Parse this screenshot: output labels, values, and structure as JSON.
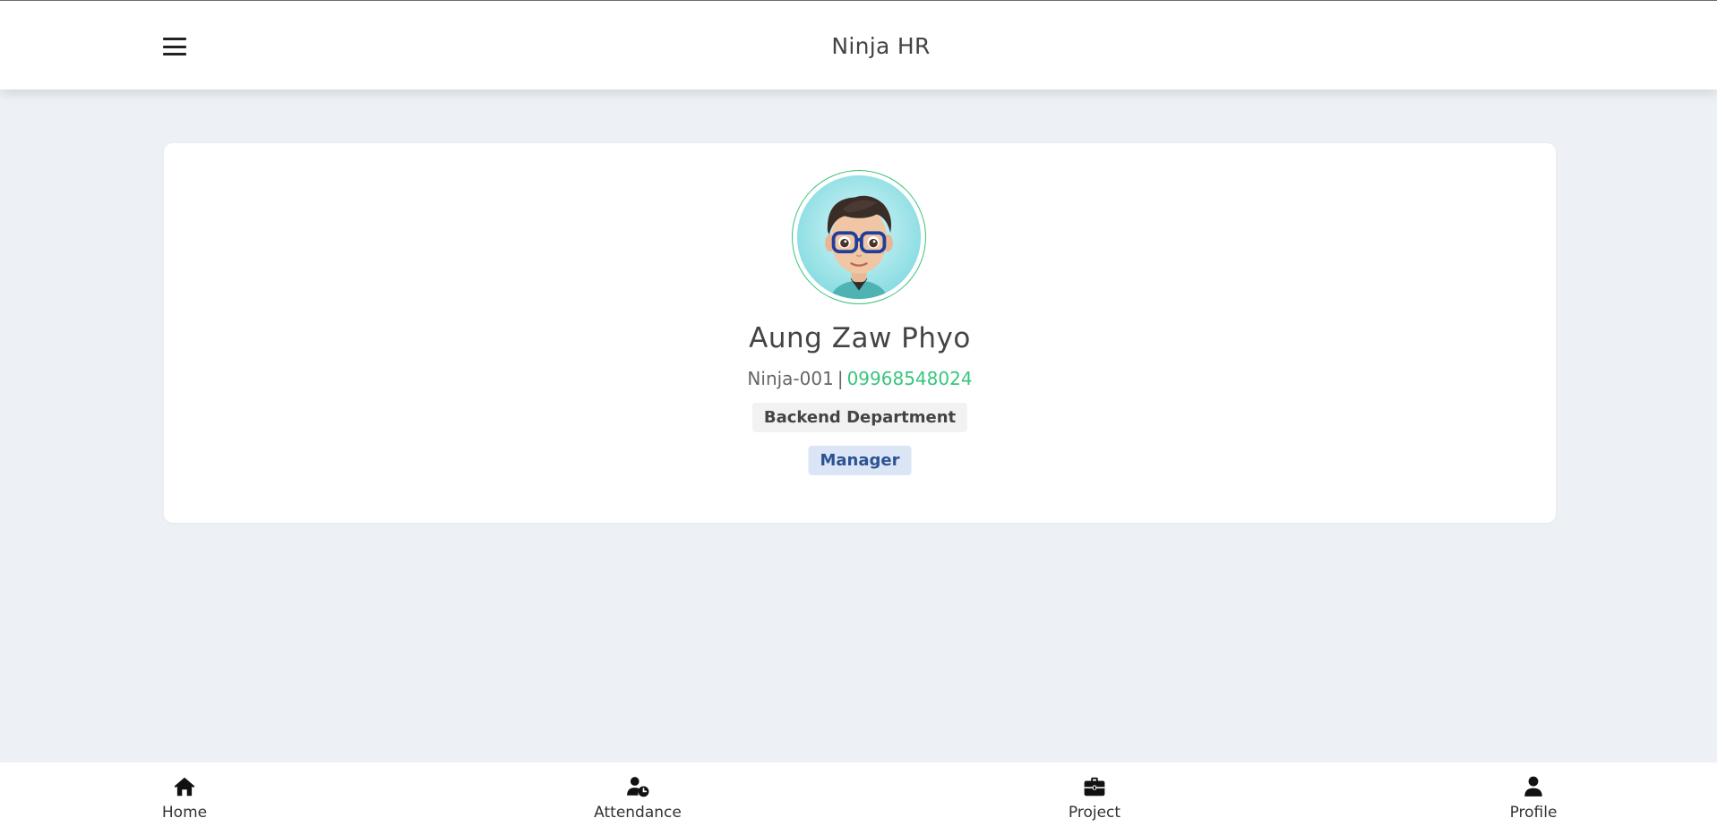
{
  "header": {
    "title": "Ninja HR",
    "menu_icon": "hamburger-menu-icon"
  },
  "profile": {
    "name": "Aung Zaw Phyo",
    "employee_id": "Ninja-001",
    "separator": "|",
    "phone": "09968548024",
    "department": "Backend Department",
    "role": "Manager"
  },
  "bottom_nav": {
    "items": [
      {
        "label": "Home",
        "icon": "home-icon"
      },
      {
        "label": "Attendance",
        "icon": "user-clock-icon"
      },
      {
        "label": "Project",
        "icon": "briefcase-icon"
      },
      {
        "label": "Profile",
        "icon": "user-icon"
      }
    ]
  },
  "colors": {
    "background": "#edf1f5",
    "accent_green": "#3ac47d",
    "role_badge_text": "#2d5394",
    "role_badge_bg": "#dbe5f5"
  }
}
